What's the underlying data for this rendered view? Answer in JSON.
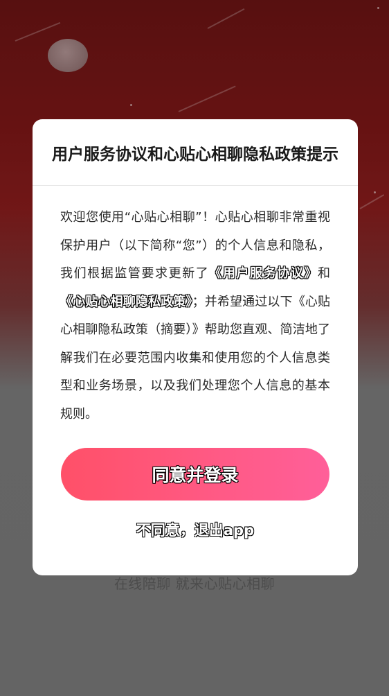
{
  "background": {
    "slogan": "在线陪聊 就来心贴心相聊",
    "colors": {
      "top": "#7d1717",
      "bottom": "#7b7b7b"
    }
  },
  "dialog": {
    "title": "用户服务协议和心贴心相聊隐私政策提示",
    "body": {
      "part1": "欢迎您使用“心贴心相聊”！心贴心相聊非常重视保护用户（以下简称“您”）的个人信息和隐私，我们根据监管要求更新了",
      "link_terms": "《用户服务协议》",
      "part2": "和",
      "link_privacy": "《心贴心相聊隐私政策》",
      "part3": "；并希望通过以下《心贴心相聊隐私政策（摘要）》帮助您直观、简洁地了解我们在必要范围内收集和使用您的个人信息类型和业务场景，以及我们处理您个人信息的基本规则。"
    },
    "agree_label": "同意并登录",
    "disagree_label": "不同意，退出app",
    "accent_color": "#ff5a86"
  }
}
